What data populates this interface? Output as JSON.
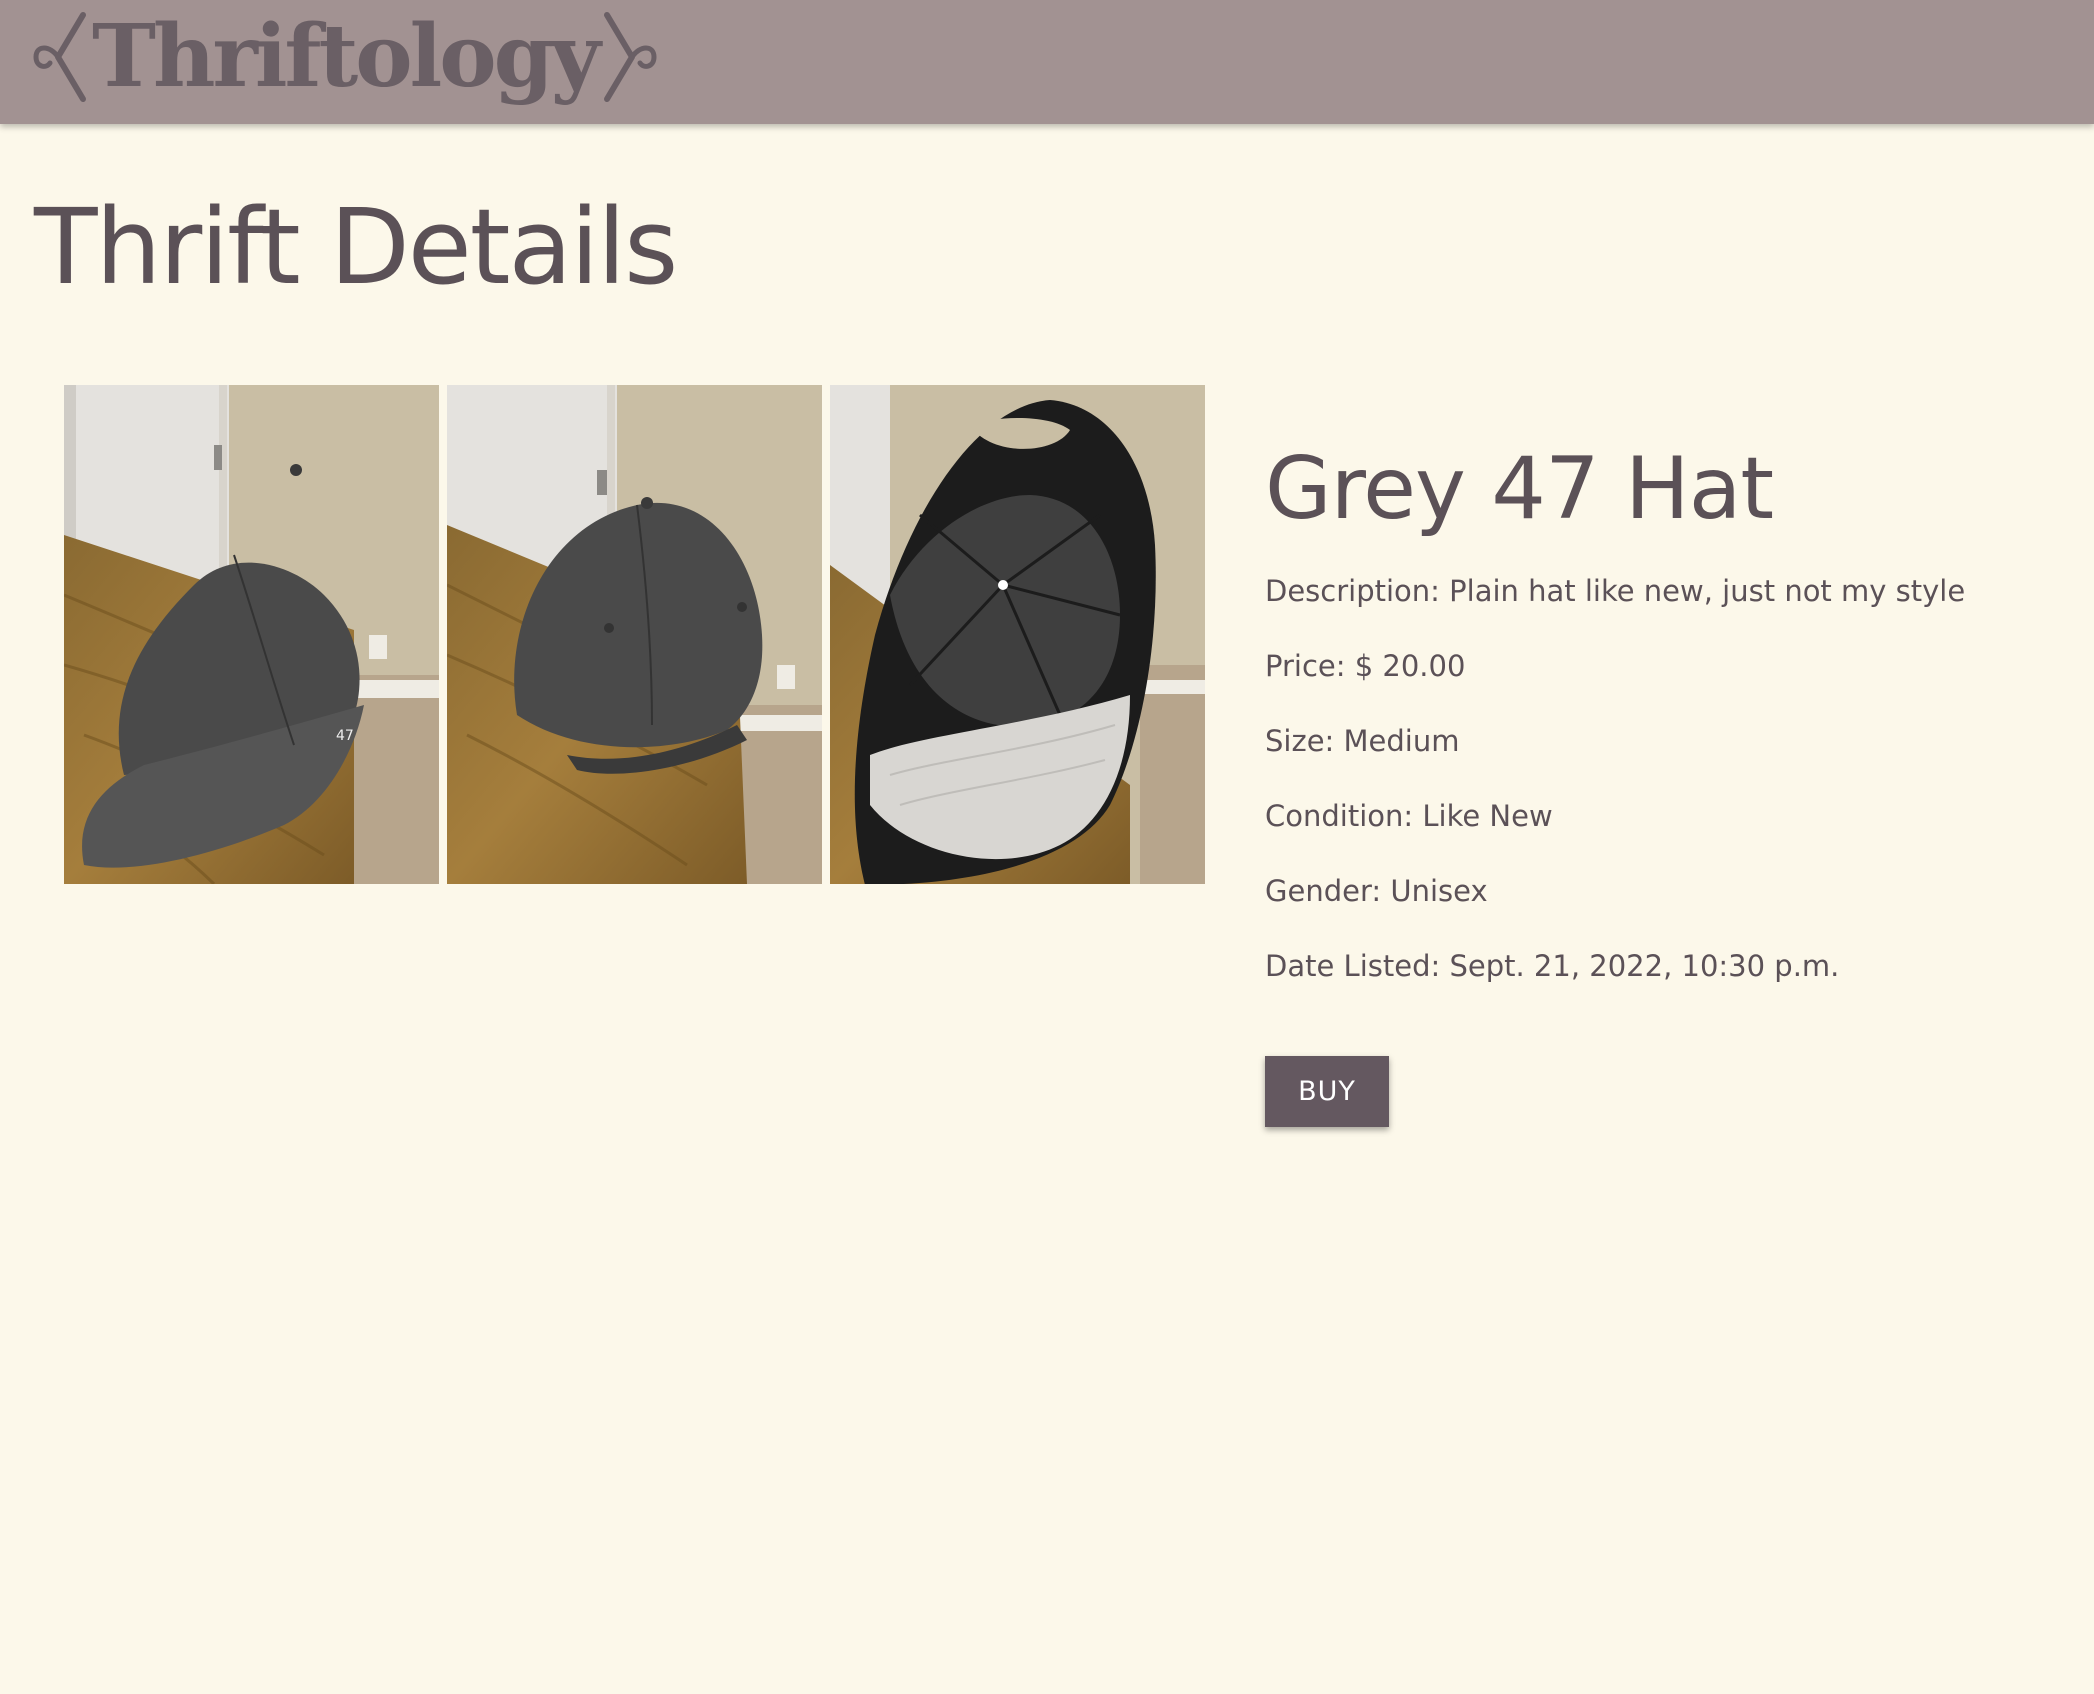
{
  "nav": {
    "logo_text": "Thriftology"
  },
  "page": {
    "title": "Thrift Details"
  },
  "item": {
    "name": "Grey 47 Hat",
    "fields": [
      {
        "label": "Description:",
        "value": "Plain hat like new, just not my style"
      },
      {
        "label": "Price:",
        "value": "$ 20.00"
      },
      {
        "label": "Size:",
        "value": "Medium"
      },
      {
        "label": "Condition:",
        "value": "Like New"
      },
      {
        "label": "Gender:",
        "value": "Unisex"
      },
      {
        "label": "Date Listed:",
        "value": "Sept. 21, 2022, 10:30 p.m."
      }
    ],
    "buy_label": "BUY"
  },
  "photos": [
    {
      "view": "front"
    },
    {
      "view": "back"
    },
    {
      "view": "underside"
    }
  ],
  "colors": {
    "navbar": "#a29292",
    "background": "#fcf8ea",
    "text": "#5b5157",
    "button": "#645860"
  }
}
